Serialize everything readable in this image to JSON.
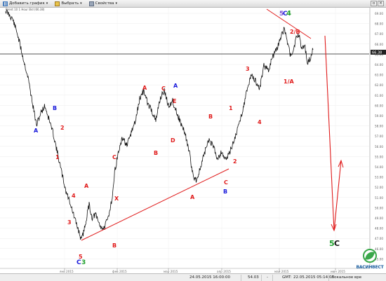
{
  "toolbar": {
    "add_chart_label": "Добавить график",
    "select_label": "Выбрать",
    "properties_label": "Свойства"
  },
  "chart_header": "Brent 10 1 Hour Bid (66.38)",
  "price_tag": "66.38",
  "y_ticks": [
    "69.00",
    "68.00",
    "67.00",
    "66.00",
    "65.00",
    "64.00",
    "63.00",
    "62.00",
    "61.00",
    "60.00",
    "59.00",
    "58.00",
    "57.00",
    "56.00",
    "55.00",
    "54.00",
    "53.00",
    "52.00",
    "51.00",
    "50.00",
    "49.00",
    "48.00",
    "47.00",
    "46.00",
    "45.00"
  ],
  "x_ticks": [
    "янв 2015",
    "фев 2015",
    "мар 2015",
    "апр 2015",
    "май 2015",
    "июн 2015"
  ],
  "wave_labels": [
    {
      "text": "A",
      "color": "#1a1adb"
    },
    {
      "text": "B",
      "color": "#1a1adb"
    },
    {
      "text": "2",
      "color": "#e01b1b"
    },
    {
      "text": "1",
      "color": "#e01b1b"
    },
    {
      "text": "4",
      "color": "#e01b1b"
    },
    {
      "text": "3",
      "color": "#e01b1b"
    },
    {
      "text": "A",
      "color": "#e01b1b"
    },
    {
      "text": "5",
      "color": "#e01b1b"
    },
    {
      "text": "C",
      "color": "#1a1adb"
    },
    {
      "text": "3",
      "color": "#1e9e2c"
    },
    {
      "text": "B",
      "color": "#e01b1b"
    },
    {
      "text": "C",
      "color": "#e01b1b"
    },
    {
      "text": "X",
      "color": "#e01b1b"
    },
    {
      "text": "A",
      "color": "#e01b1b"
    },
    {
      "text": "B",
      "color": "#e01b1b"
    },
    {
      "text": "C",
      "color": "#e01b1b"
    },
    {
      "text": "A",
      "color": "#1a1adb"
    },
    {
      "text": "E",
      "color": "#e01b1b"
    },
    {
      "text": "D",
      "color": "#e01b1b"
    },
    {
      "text": "A",
      "color": "#e01b1b"
    },
    {
      "text": "B",
      "color": "#e01b1b"
    },
    {
      "text": "C",
      "color": "#e01b1b"
    },
    {
      "text": "B",
      "color": "#1a1adb"
    },
    {
      "text": "1",
      "color": "#e01b1b"
    },
    {
      "text": "2",
      "color": "#e01b1b"
    },
    {
      "text": "3",
      "color": "#e01b1b"
    },
    {
      "text": "4",
      "color": "#e01b1b"
    },
    {
      "text": "1/A",
      "color": "#e01b1b"
    },
    {
      "text": "2/B",
      "color": "#e01b1b"
    },
    {
      "text": "5",
      "color": "#7a4fd0"
    },
    {
      "text": "C",
      "color": "#1a1adb"
    },
    {
      "text": "4",
      "color": "#1e9e2c"
    },
    {
      "text": "5",
      "color": "#1e9e2c"
    },
    {
      "text": "C",
      "color": "#111111"
    }
  ],
  "status": {
    "time": "24.05.2015 16:00:00",
    "value": "54.03",
    "value2": "-",
    "gmt_label": "GMT:",
    "gmt_time": "22.05.2015 05:14:06",
    "local_label": "Локальное вре"
  },
  "logo_text": "ВАСИНВЕСТ",
  "colors": {
    "wave_red": "#e01b1b",
    "wave_blue": "#1a1adb",
    "wave_green": "#1e9e2c",
    "price_line": "#111111",
    "trend_line": "#e01b1b",
    "forecast": "#e01b1b"
  }
}
